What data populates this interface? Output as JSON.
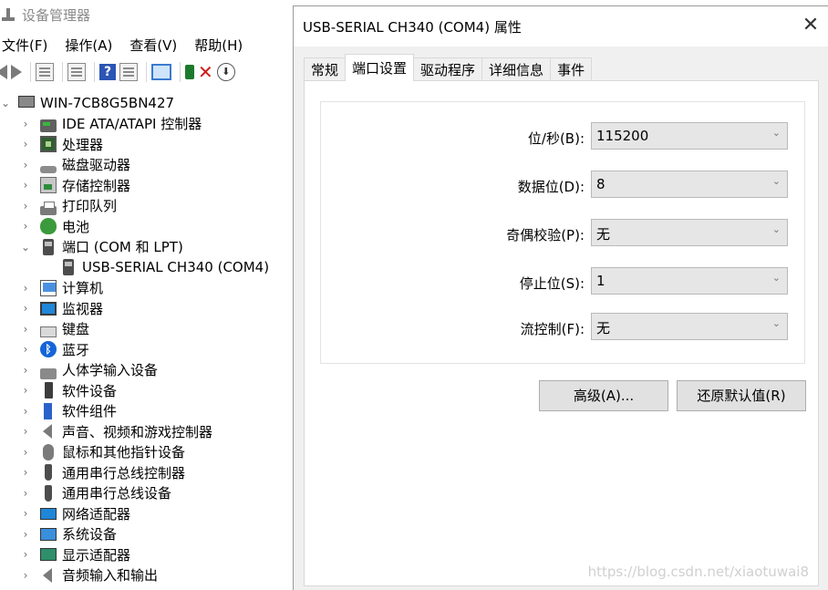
{
  "device_manager": {
    "title": "设备管理器",
    "menu": [
      "文件(F)",
      "操作(A)",
      "查看(V)",
      "帮助(H)"
    ],
    "toolbar_icons": [
      "back-icon",
      "forward-icon",
      "properties-view-icon",
      "list-icon",
      "help-icon",
      "details-icon",
      "scan-monitor-icon",
      "update-driver-icon",
      "uninstall-icon",
      "disable-icon"
    ],
    "computer_name": "WIN-7CB8G5BN427",
    "categories": [
      {
        "label": "IDE ATA/ATAPI 控制器",
        "icon": "ide-controller-icon"
      },
      {
        "label": "处理器",
        "icon": "processor-icon"
      },
      {
        "label": "磁盘驱动器",
        "icon": "disk-drive-icon"
      },
      {
        "label": "存储控制器",
        "icon": "storage-controller-icon"
      },
      {
        "label": "打印队列",
        "icon": "printer-icon"
      },
      {
        "label": "电池",
        "icon": "battery-icon"
      },
      {
        "label": "端口 (COM 和 LPT)",
        "icon": "port-icon",
        "expanded": true
      },
      {
        "label": "USB-SERIAL CH340 (COM4)",
        "icon": "port-icon",
        "child": true
      },
      {
        "label": "计算机",
        "icon": "computer-icon"
      },
      {
        "label": "监视器",
        "icon": "monitor-icon"
      },
      {
        "label": "键盘",
        "icon": "keyboard-icon"
      },
      {
        "label": "蓝牙",
        "icon": "bluetooth-icon"
      },
      {
        "label": "人体学输入设备",
        "icon": "hid-icon"
      },
      {
        "label": "软件设备",
        "icon": "software-device-icon"
      },
      {
        "label": "软件组件",
        "icon": "software-component-icon"
      },
      {
        "label": "声音、视频和游戏控制器",
        "icon": "sound-icon"
      },
      {
        "label": "鼠标和其他指针设备",
        "icon": "mouse-icon"
      },
      {
        "label": "通用串行总线控制器",
        "icon": "usb-icon"
      },
      {
        "label": "通用串行总线设备",
        "icon": "usb-icon"
      },
      {
        "label": "网络适配器",
        "icon": "network-adapter-icon"
      },
      {
        "label": "系统设备",
        "icon": "system-device-icon"
      },
      {
        "label": "显示适配器",
        "icon": "display-adapter-icon"
      },
      {
        "label": "音频输入和输出",
        "icon": "audio-icon"
      }
    ]
  },
  "dialog": {
    "title": "USB-SERIAL CH340 (COM4) 属性",
    "tabs": [
      "常规",
      "端口设置",
      "驱动程序",
      "详细信息",
      "事件"
    ],
    "active_tab": "端口设置",
    "fields": [
      {
        "label": "位/秒(B):",
        "value": "115200"
      },
      {
        "label": "数据位(D):",
        "value": "8"
      },
      {
        "label": "奇偶校验(P):",
        "value": "无"
      },
      {
        "label": "停止位(S):",
        "value": "1"
      },
      {
        "label": "流控制(F):",
        "value": "无"
      }
    ],
    "buttons": {
      "advanced": "高级(A)...",
      "restore": "还原默认值(R)"
    }
  },
  "watermark": "https://blog.csdn.net/xiaotuwai8"
}
